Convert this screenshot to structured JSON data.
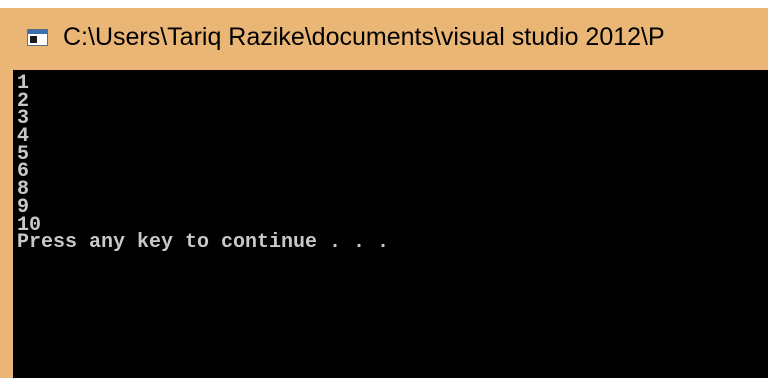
{
  "window": {
    "title": "C:\\Users\\Tariq Razike\\documents\\visual studio 2012\\P",
    "icon": "console-app-icon"
  },
  "console": {
    "lines": [
      "1",
      "2",
      "3",
      "4",
      "5",
      "6",
      "8",
      "9",
      "10",
      "Press any key to continue . . ."
    ]
  },
  "colors": {
    "title_bar": "#e9b676",
    "console_background": "#000000",
    "console_text": "#c8c8c8"
  }
}
